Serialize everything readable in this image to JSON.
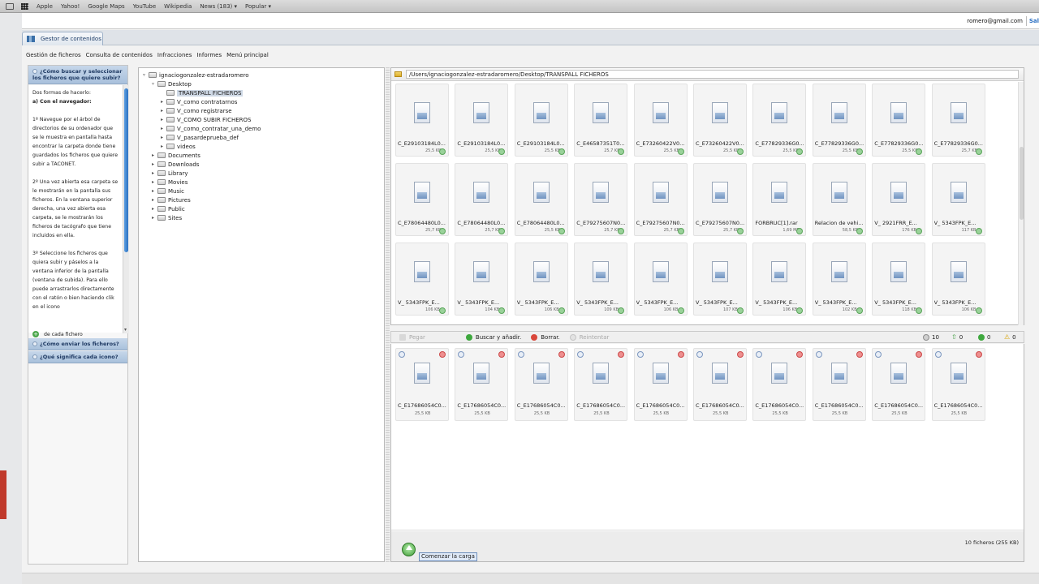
{
  "bookmarks": [
    "Apple",
    "Yahoo!",
    "Google Maps",
    "YouTube",
    "Wikipedia",
    "News (183) ▾",
    "Popular ▾"
  ],
  "user": {
    "email": "romero@gmail.com",
    "logout": "Sal"
  },
  "tab": {
    "label": "Gestor de contenidos"
  },
  "menu": [
    "Gestión de ficheros",
    "Consulta de contenidos",
    "Infracciones",
    "Informes",
    "Menú principal"
  ],
  "help": {
    "q1": "¿Cómo buscar y seleccionar los ficheros que quiere subir?",
    "p_intro": "Dos formas de hacerlo:",
    "p_nav": "a) Con el navegador:",
    "p1": "1º Navegue por el árbol de directorios de su ordenador que se le muestra en pantalla hasta encontrar la carpeta donde tiene guardados los ficheros que quiere subir a TACONET.",
    "p2": "2º Una vez abierta esa carpeta se le mostrarán en la pantalla sus ficheros. En la ventana superior derecha, una vez abierta esa carpeta, se le mostrarán los ficheros de tacógrafo que tiene incluidos en ella.",
    "p3": "3º Seleccione los ficheros que quiera subir y páselos a la ventana inferior de la pantalla (ventana de subida). Para ello puede arrastrarlos directamente con el ratón o bien haciendo clik en el icono",
    "p_add": "de cada fichero",
    "q2": "¿Cómo enviar los ficheros?",
    "q3": "¿Qué significa cada icono?"
  },
  "tree": {
    "root": "ignaciogonzalez-estradaromero",
    "desktop": "Desktop",
    "desktop_children": [
      "TRANSPALL FICHEROS",
      "V_como contratarnos",
      "V_como registrarse",
      "V_COMO SUBIR FICHEROS",
      "V_como_contratar_una_demo",
      "V_pasardeprueba_def",
      "videos"
    ],
    "others": [
      "Documents",
      "Downloads",
      "Library",
      "Movies",
      "Music",
      "Pictures",
      "Public",
      "Sites"
    ]
  },
  "files": {
    "path": "/Users/ignaciogonzalez-estradaromero/Desktop/TRANSPALL FICHEROS",
    "rows": [
      [
        {
          "name": "C_E29103184L0...",
          "size": "25,5 KB"
        },
        {
          "name": "C_E29103184L0...",
          "size": "25,5 KB"
        },
        {
          "name": "C_E29103184L0...",
          "size": "25,5 KB"
        },
        {
          "name": "C_E46587351T0...",
          "size": "25,7 KB"
        },
        {
          "name": "C_E73260422V0...",
          "size": "25,5 KB"
        },
        {
          "name": "C_E73260422V0...",
          "size": "25,5 KB"
        },
        {
          "name": "C_E77829336G0...",
          "size": "25,5 KB"
        },
        {
          "name": "C_E77829336G0...",
          "size": "25,5 KB"
        },
        {
          "name": "C_E77829336G0...",
          "size": "25,5 KB"
        },
        {
          "name": "C_E77829336G0...",
          "size": "25,7 KB"
        }
      ],
      [
        {
          "name": "C_E78064480L0...",
          "size": "25,7 KB"
        },
        {
          "name": "C_E78064480L0...",
          "size": "25,7 KB"
        },
        {
          "name": "C_E78064480L0...",
          "size": "25,5 KB"
        },
        {
          "name": "C_E79275607N0...",
          "size": "25,7 KB"
        },
        {
          "name": "C_E79275607N0...",
          "size": "25,7 KB"
        },
        {
          "name": "C_E79275607N0...",
          "size": "25,7 KB"
        },
        {
          "name": "FORBRUC[1].rar",
          "size": "1,69 MB"
        },
        {
          "name": "Relacion de vehi...",
          "size": "58,5 KB"
        },
        {
          "name": "V_     2921FRR_E...",
          "size": "176 KB"
        },
        {
          "name": "V_     5343FPK_E...",
          "size": "117 KB"
        }
      ],
      [
        {
          "name": "V_     5343FPK_E...",
          "size": "106 KB"
        },
        {
          "name": "V_     5343FPK_E...",
          "size": "104 KB"
        },
        {
          "name": "V_     5343FPK_E...",
          "size": "106 KB"
        },
        {
          "name": "V_     5343FPK_E...",
          "size": "109 KB"
        },
        {
          "name": "V_     5343FPK_E...",
          "size": "106 KB"
        },
        {
          "name": "V_     5343FPK_E...",
          "size": "107 KB"
        },
        {
          "name": "V_     5343FPK_E...",
          "size": "106 KB"
        },
        {
          "name": "V_     5343FPK_E...",
          "size": "102 KB"
        },
        {
          "name": "V_     5343FPK_E...",
          "size": "118 KB"
        },
        {
          "name": "V_     5343FPK_E...",
          "size": "106 KB"
        }
      ]
    ]
  },
  "toolbar": {
    "paste": "Pegar",
    "search_add": "Buscar y añadir.",
    "delete": "Borrar.",
    "retry": "Reintentar",
    "count_total": "10",
    "count_up": "0",
    "count_ok": "0",
    "count_warn": "0"
  },
  "upload": {
    "files": [
      {
        "name": "C_E17686054C0...",
        "size": "25,5 KB"
      },
      {
        "name": "C_E17686054C0...",
        "size": "25,5 KB"
      },
      {
        "name": "C_E17686054C0...",
        "size": "25,5 KB"
      },
      {
        "name": "C_E17686054C0...",
        "size": "25,5 KB"
      },
      {
        "name": "C_E17686054C0...",
        "size": "25,5 KB"
      },
      {
        "name": "C_E17686054C0...",
        "size": "25,5 KB"
      },
      {
        "name": "C_E17686054C0...",
        "size": "25,5 KB"
      },
      {
        "name": "C_E17686054C0...",
        "size": "25,5 KB"
      },
      {
        "name": "C_E17686054C0...",
        "size": "25,5 KB"
      },
      {
        "name": "C_E17686054C0...",
        "size": "25,5 KB"
      }
    ],
    "file_count": "10 ficheros (255 KB)",
    "start_tooltip": "Comenzar la carga"
  },
  "icons": {
    "folder": "folder-icon",
    "file": "document-icon",
    "ok": "check-circle-icon",
    "delete": "delete-circle-icon",
    "upload": "upload-arrow-icon"
  }
}
